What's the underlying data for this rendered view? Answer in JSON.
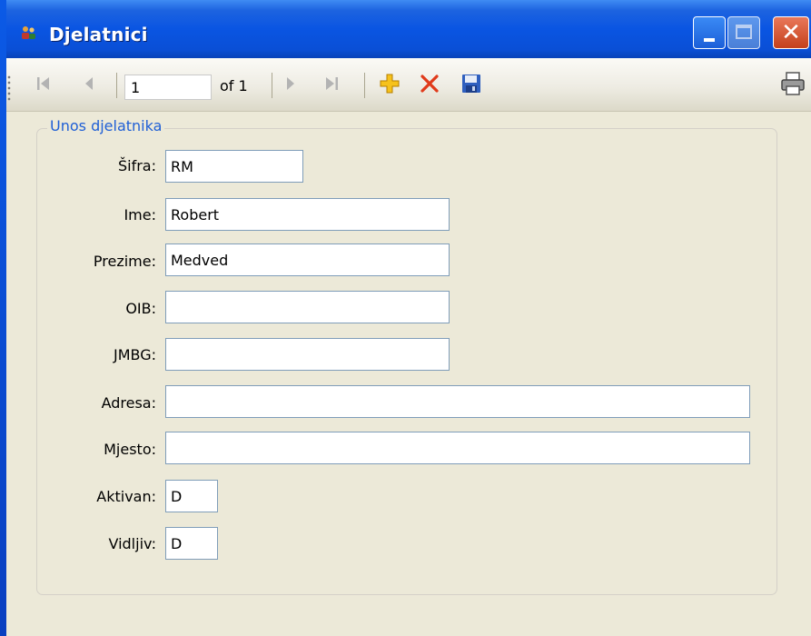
{
  "window": {
    "title": "Djelatnici",
    "buttons": {
      "minimize": "minimize",
      "maximize": "maximize",
      "close": "close"
    }
  },
  "toolbar": {
    "position_value": "1",
    "of_label": "of 1",
    "icons": [
      "move-first-icon",
      "move-previous-icon",
      "move-next-icon",
      "move-last-icon",
      "add-new-icon",
      "delete-icon",
      "save-icon",
      "print-icon"
    ],
    "colors": {
      "add": "#f0b400",
      "delete": "#e03a1a",
      "save": "#2e5fbf"
    }
  },
  "group": {
    "title": "Unos djelatnika",
    "color": "#1f5fd6"
  },
  "fields": {
    "sifra": {
      "label": "Šifra:",
      "value": "RM"
    },
    "ime": {
      "label": "Ime:",
      "value": "Robert"
    },
    "prezime": {
      "label": "Prezime:",
      "value": "Medved"
    },
    "oib": {
      "label": "OIB:",
      "value": ""
    },
    "jmbg": {
      "label": "JMBG:",
      "value": ""
    },
    "adresa": {
      "label": "Adresa:",
      "value": ""
    },
    "mjesto": {
      "label": "Mjesto:",
      "value": ""
    },
    "aktivan": {
      "label": "Aktivan:",
      "value": "D"
    },
    "vidljiv": {
      "label": "Vidljiv:",
      "value": "D"
    }
  }
}
